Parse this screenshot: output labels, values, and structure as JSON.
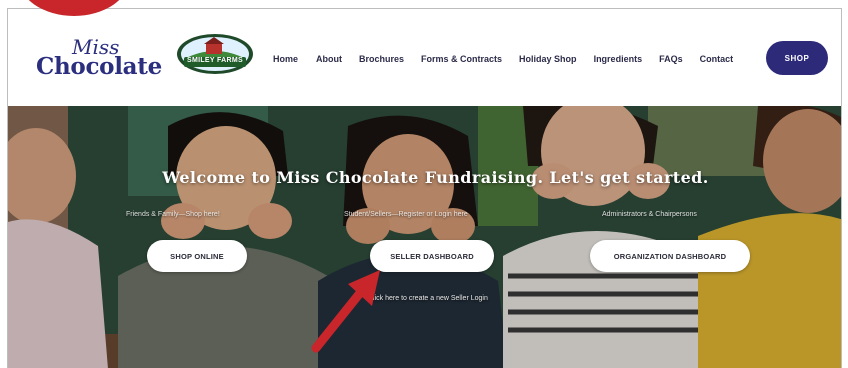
{
  "brand": {
    "logo_top": "Miss",
    "logo_main": "Chocolate",
    "partner": "SMILEY FARMS"
  },
  "nav": {
    "items": [
      "Home",
      "About",
      "Brochures",
      "Forms & Contracts",
      "Holiday Shop",
      "Ingredients",
      "FAQs",
      "Contact"
    ],
    "shop_label": "SHOP"
  },
  "hero": {
    "title": "Welcome to Miss Chocolate Fundraising. Let's get started.",
    "columns": [
      {
        "subtitle": "Friends & Family—Shop here!",
        "button": "SHOP ONLINE"
      },
      {
        "subtitle": "Student/Sellers—Register or Login here",
        "button": "SELLER DASHBOARD"
      },
      {
        "subtitle": "Administrators & Chairpersons",
        "button": "ORGANIZATION DASHBOARD"
      }
    ],
    "link": "Click here to create a new Seller Login"
  },
  "colors": {
    "brand_navy": "#2d2a7a",
    "annotation_red": "#c8262b"
  }
}
